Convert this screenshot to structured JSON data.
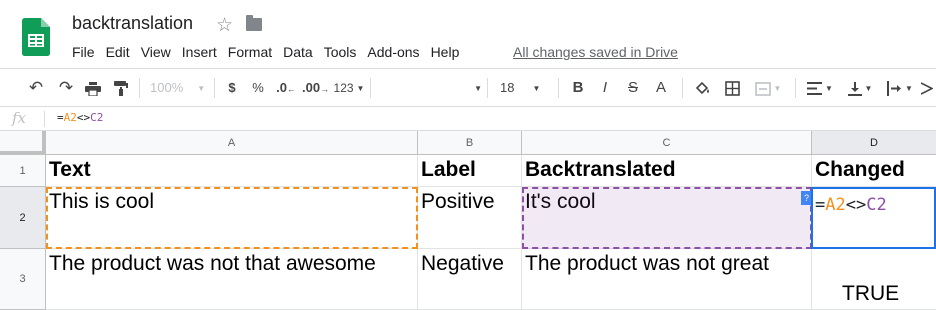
{
  "app": {
    "doc_title": "backtranslation",
    "save_status": "All changes saved in Drive",
    "icons": [
      "sheets-logo-icon",
      "star-icon",
      "folder-icon"
    ]
  },
  "menu": [
    "File",
    "Edit",
    "View",
    "Insert",
    "Format",
    "Data",
    "Tools",
    "Add-ons",
    "Help"
  ],
  "toolbar": {
    "zoom": "100%",
    "currency": "$",
    "percent": "%",
    "decimal_decrease": ".0",
    "decimal_increase": ".00",
    "more_formats": "123",
    "font_size": "18",
    "bold": "B",
    "italic": "I",
    "strike": "S",
    "text_color": "A"
  },
  "formula_bar": {
    "fx_label": "fx",
    "prefix": "=",
    "ref1": "A2",
    "op": "<>",
    "ref2": "C2"
  },
  "columns": [
    "A",
    "B",
    "C",
    "D"
  ],
  "rows": [
    "1",
    "2",
    "3"
  ],
  "cells": {
    "A1": "Text",
    "B1": "Label",
    "C1": "Backtranslated",
    "D1": "Changed",
    "A2": "This is cool",
    "B2": "Positive",
    "C2": "It's cool",
    "A3": "The product was not that awesome",
    "B3": "Negative",
    "C3": "The product was not great",
    "D3": "TRUE"
  },
  "active_cell": {
    "ref": "D2",
    "prefix": "=",
    "ref1": "A2",
    "op": "<>",
    "ref2": "C2",
    "help_tag": "?"
  },
  "colors": {
    "ref1_color": "#f4911e",
    "ref2_color": "#8e4fa8",
    "active_border": "#1a73e8",
    "brand": "#0f9d58"
  }
}
